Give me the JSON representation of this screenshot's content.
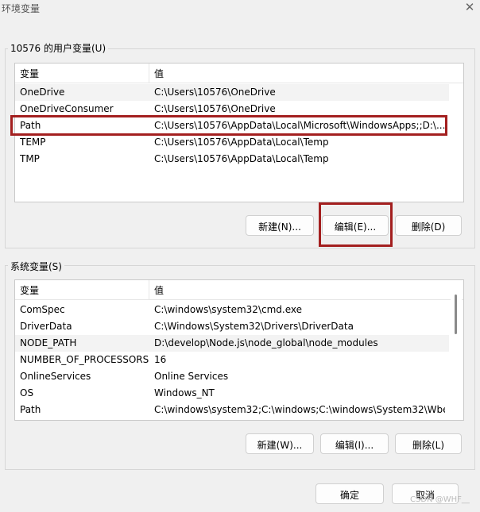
{
  "window": {
    "title": "环境变量",
    "close_glyph": "✕"
  },
  "user_vars": {
    "label": "10576 的用户变量(U)",
    "col_name": "变量",
    "col_value": "值",
    "rows": [
      {
        "name": "OneDrive",
        "value": "C:\\Users\\10576\\OneDrive"
      },
      {
        "name": "OneDriveConsumer",
        "value": "C:\\Users\\10576\\OneDrive"
      },
      {
        "name": "Path",
        "value": "C:\\Users\\10576\\AppData\\Local\\Microsoft\\WindowsApps;;D:\\..."
      },
      {
        "name": "TEMP",
        "value": "C:\\Users\\10576\\AppData\\Local\\Temp"
      },
      {
        "name": "TMP",
        "value": "C:\\Users\\10576\\AppData\\Local\\Temp"
      }
    ],
    "buttons": {
      "new": "新建(N)...",
      "edit": "编辑(E)...",
      "delete": "删除(D)"
    }
  },
  "system_vars": {
    "label": "系统变量(S)",
    "col_name": "变量",
    "col_value": "值",
    "rows": [
      {
        "name": "ComSpec",
        "value": "C:\\windows\\system32\\cmd.exe"
      },
      {
        "name": "DriverData",
        "value": "C:\\Windows\\System32\\Drivers\\DriverData"
      },
      {
        "name": "NODE_PATH",
        "value": "D:\\develop\\Node.js\\node_global\\node_modules"
      },
      {
        "name": "NUMBER_OF_PROCESSORS",
        "value": "16"
      },
      {
        "name": "OnlineServices",
        "value": "Online Services"
      },
      {
        "name": "OS",
        "value": "Windows_NT"
      },
      {
        "name": "Path",
        "value": "C:\\windows\\system32;C:\\windows;C:\\windows\\System32\\Wbe..."
      }
    ],
    "buttons": {
      "new": "新建(W)...",
      "edit": "编辑(I)...",
      "delete": "删除(L)"
    }
  },
  "footer": {
    "ok": "确定",
    "cancel": "取消"
  },
  "watermark": "CSDN @WHF__",
  "colors": {
    "highlight": "#a31f1f",
    "selected_row": "#f3f3f3"
  }
}
